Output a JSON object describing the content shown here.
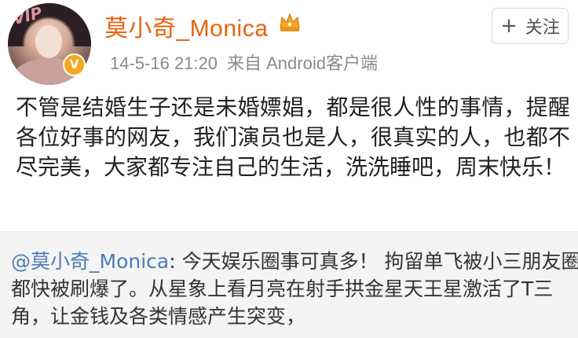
{
  "user": {
    "name": "莫小奇_Monica",
    "avatar_watermark": "VIP",
    "verified_mark": "V"
  },
  "post": {
    "date": "14-5-16 21:20",
    "source": "来自 Android客户端",
    "text": "不管是结婚生子还是未婚嫖娼，都是很人性的事情，提醒各位好事的网友，我们演员也是人，很真实的人，也都不尽完美，大家都专注自己的生活，洗洗睡吧，周末快乐！"
  },
  "follow_button": {
    "icon": "+",
    "label": "关注"
  },
  "repost": {
    "author": "@莫小奇_Monica",
    "text": ": 今天娱乐圈事可真多！ 拘留单飞被小三朋友圈都快被刷爆了。从星象上看月亮在射手拱金星天王星激活了T三角，让金钱及各类情感产生突变，"
  },
  "colors": {
    "username": "#e8620b",
    "link": "#4b7cb8",
    "meta": "#8a8a8a",
    "repost_bg": "#f4f4f4",
    "crown": "#f5a623"
  },
  "icons": [
    "crown-icon",
    "plus-icon",
    "verified-badge-icon"
  ]
}
